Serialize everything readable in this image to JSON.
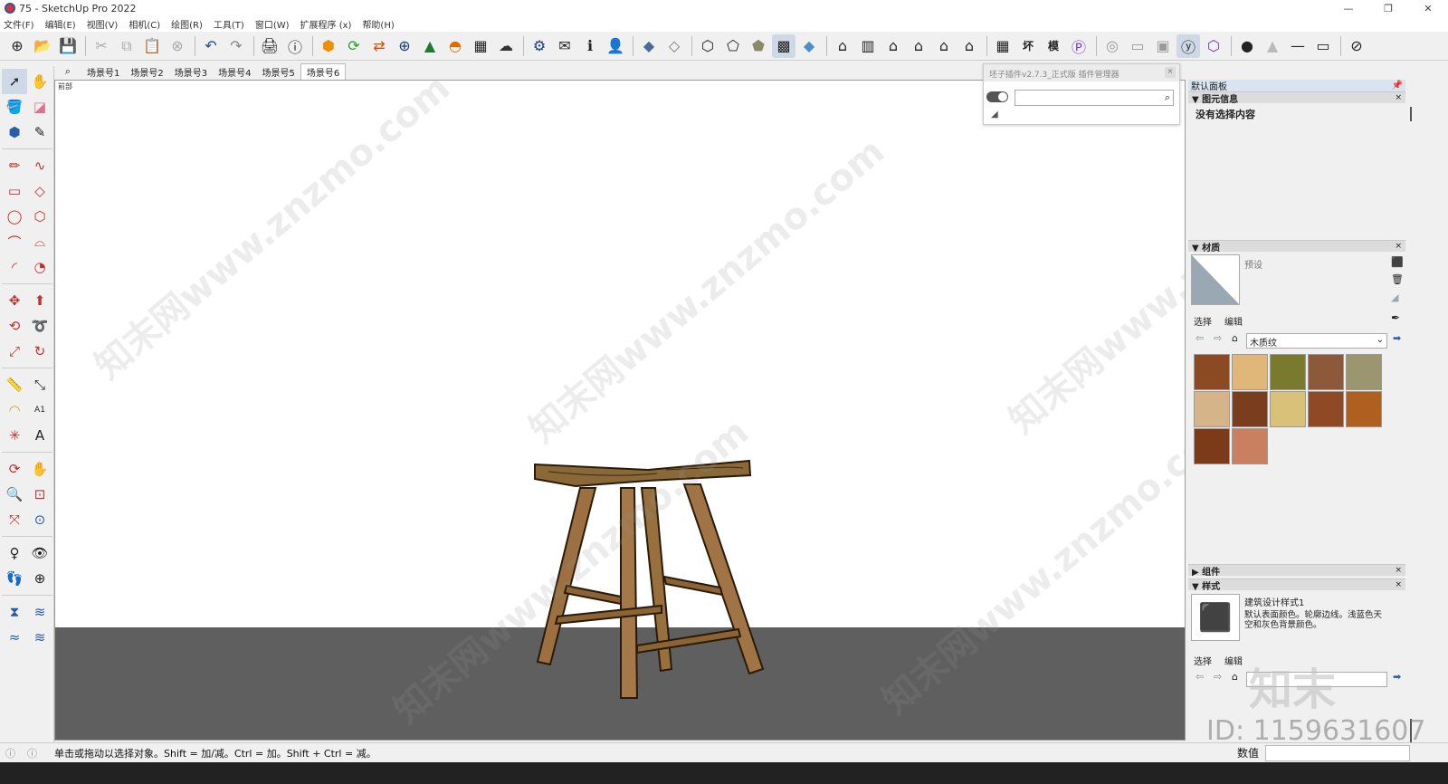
{
  "window": {
    "title": "75 - SketchUp Pro 2022"
  },
  "menu": [
    "文件(F)",
    "编辑(E)",
    "视图(V)",
    "相机(C)",
    "绘图(R)",
    "工具(T)",
    "窗口(W)",
    "扩展程序 (x)",
    "帮助(H)"
  ],
  "scenes": {
    "tabs": [
      "场景号1",
      "场景号2",
      "场景号3",
      "场景号4",
      "场景号5",
      "场景号6"
    ],
    "active": 5
  },
  "viewport": {
    "label": "前部"
  },
  "plugin": {
    "title": "坯子插件v2.7.3_正式版 插件管理器"
  },
  "tray": {
    "title": "默认面板",
    "entity_info": {
      "header": "图元信息",
      "text": "没有选择内容"
    },
    "materials": {
      "header": "材质",
      "name": "预设",
      "tab_select": "选择",
      "tab_edit": "编辑",
      "library": "木质纹",
      "swatch_colors": [
        "#8b4a22",
        "#e0b778",
        "#7a7a2e",
        "#8c5a3a",
        "#9c9670",
        "#d6b48a",
        "#7a3e1e",
        "#d8c27a",
        "#8e4a24",
        "#b0601e",
        "#7b3a18",
        "#c98060"
      ]
    },
    "components": {
      "header": "组件"
    },
    "styles": {
      "header": "样式",
      "name": "建筑设计样式1",
      "description": "默认表面颜色。轮廓边线。浅蓝色天空和灰色背景颜色。",
      "tab_select": "选择",
      "tab_edit": "编辑"
    }
  },
  "status": {
    "message": "单击或拖动以选择对象。Shift = 加/减。Ctrl = 加。Shift + Ctrl = 减。",
    "measure_label": "数值"
  },
  "watermark": {
    "text": "知末网www.znzmo.com",
    "id": "ID: 1159631607",
    "logo": "知末"
  }
}
